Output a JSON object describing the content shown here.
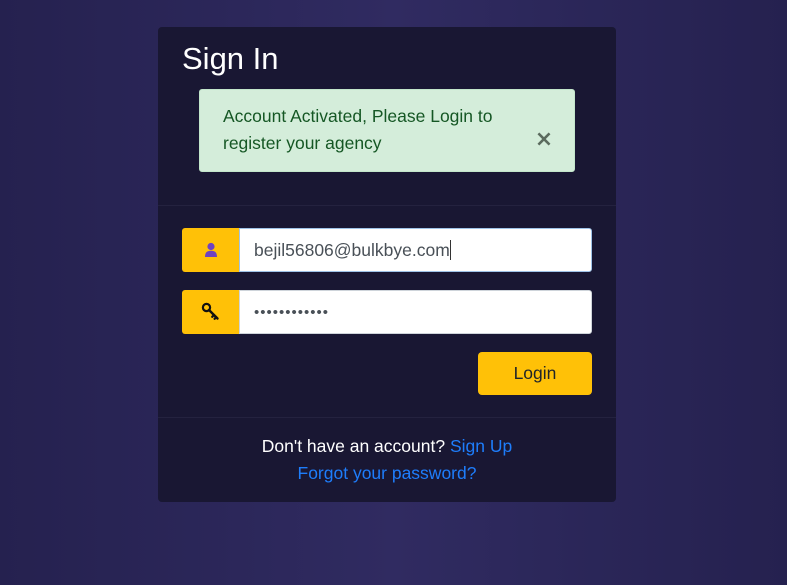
{
  "form": {
    "title": "Sign In",
    "alert": {
      "message": "Account Activated, Please Login to register your agency",
      "close_glyph": "×"
    },
    "email": {
      "value": "bejil56806@bulkbye.com",
      "icon": "user-icon"
    },
    "password": {
      "masked_value": "••••••••••••",
      "icon": "key-icon"
    },
    "login_label": "Login",
    "footer": {
      "signup_prompt": "Don't have an account?",
      "signup_link": "Sign Up",
      "forgot_link": "Forgot your password?"
    }
  },
  "colors": {
    "background": "#2b2659",
    "card": "#191733",
    "accent": "#ffc107",
    "alert_bg": "#d4edda",
    "alert_text": "#155724",
    "link": "#1e7dfb"
  }
}
